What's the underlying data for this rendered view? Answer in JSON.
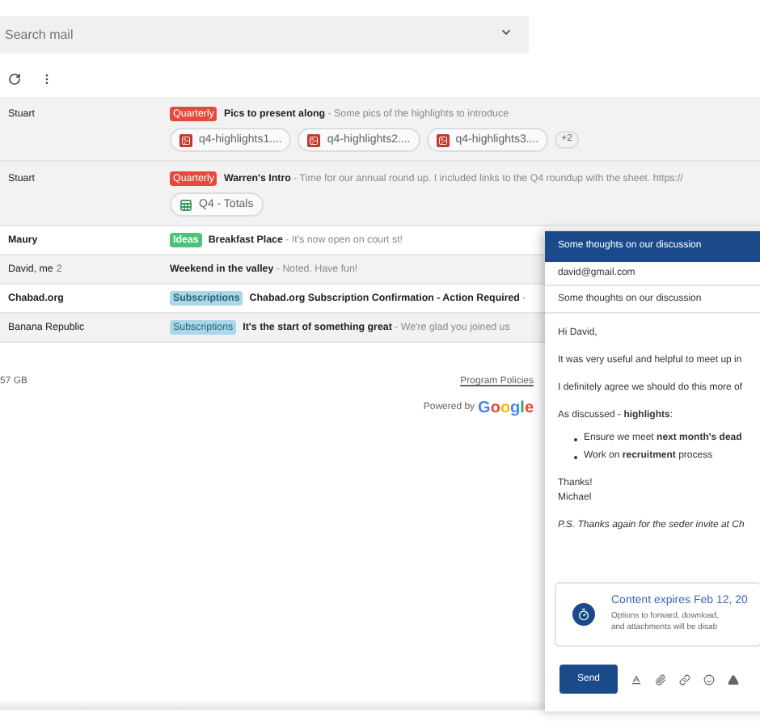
{
  "search": {
    "placeholder": "Search mail"
  },
  "emails": [
    {
      "sender": "Stuart",
      "unread": false,
      "label": {
        "text": "Quarterly",
        "color": "#e5493b"
      },
      "subject": "Pics to present along",
      "snippet": " - Some pics of the highlights to introduce",
      "attachments": [
        {
          "kind": "image",
          "name": "q4-highlights1...."
        },
        {
          "kind": "image",
          "name": "q4-highlights2...."
        },
        {
          "kind": "image",
          "name": "q4-highlights3...."
        }
      ],
      "more": "+2"
    },
    {
      "sender": "Stuart",
      "unread": false,
      "label": {
        "text": "Quarterly",
        "color": "#e5493b"
      },
      "subject": "Warren's Intro",
      "snippet": " - Time for our annual round up. I included links to the Q4 roundup with the sheet. https://",
      "attachments": [
        {
          "kind": "sheet",
          "name": "Q4 - Totals"
        }
      ]
    },
    {
      "sender": "Maury",
      "unread": true,
      "label": {
        "text": "Ideas",
        "color": "#4cc27a"
      },
      "subject": "Breakfast Place",
      "snippet": " - It's now open on court st!"
    },
    {
      "sender": "David, me",
      "count": "2",
      "unread": false,
      "subject": "Weekend in the valley",
      "snippet": " - Noted. Have fun!"
    },
    {
      "sender": "Chabad.org",
      "unread": true,
      "label": {
        "text": "Subscriptions",
        "color": "#a8d8ea"
      },
      "subject": "Chabad.org Subscription Confirmation - Action Required",
      "snippet": " -"
    },
    {
      "sender": "Banana Republic",
      "unread": false,
      "label": {
        "text": "Subscriptions",
        "color": "#a8d8ea"
      },
      "subject": "It's the start of something great",
      "snippet": " - We're glad you joined us"
    }
  ],
  "footer": {
    "storage": "57 GB",
    "policies": "Program Policies",
    "powered_by": "Powered by",
    "brand": "Google"
  },
  "compose": {
    "title": "Some thoughts on our discussion",
    "to": "david@gmail.com",
    "subject": "Some thoughts on our discussion",
    "body": [
      "Hi David,",
      "It was very useful and helpful to meet up in",
      "I definitely agree we should do this more of",
      "As discussed - **highlights**:"
    ],
    "bullets": [
      "Ensure we meet **next month's dead**",
      "Work on **recruitment** process"
    ],
    "signoff": [
      "Thanks!",
      "Michael"
    ],
    "ps": "P.S. Thanks again for the seder invite at Ch",
    "notice": {
      "title": "Content expires Feb 12, 20",
      "lines": [
        "Options to forward, download,",
        "and attachments will be disab"
      ]
    },
    "send": "Send"
  }
}
